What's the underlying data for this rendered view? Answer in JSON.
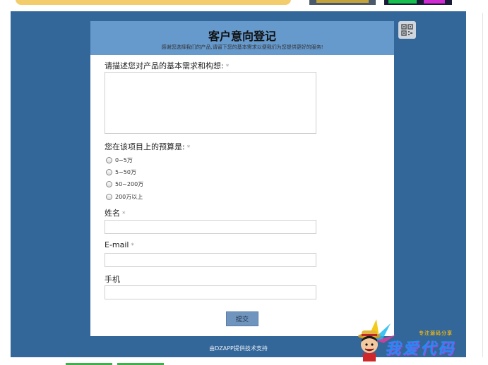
{
  "form": {
    "title": "客户意向登记",
    "subtitle": "感谢您选择我们的产品,请留下您的基本需求以便我们为您提供更好的服务!",
    "fields": {
      "needs_label": "请描述您对产品的基本需求和构想:",
      "budget_label": "您在该项目上的预算是:",
      "name_label": "姓名",
      "email_label": "E-mail",
      "phone_label": "手机"
    },
    "required_mark": "*",
    "budget_options": [
      "0~5万",
      "5~50万",
      "50~200万",
      "200万以上"
    ],
    "submit_label": "提交"
  },
  "footer": {
    "text": "由DZAPP提供技术支持"
  },
  "icons": {
    "qr": "qr-code-icon"
  },
  "watermark": {
    "small_text": "专注源码分享",
    "big_text": "我爱代码"
  },
  "colors": {
    "frame_bg": "#336699",
    "header_bg": "#6699cc",
    "submit_bg": "#6f94bd"
  }
}
